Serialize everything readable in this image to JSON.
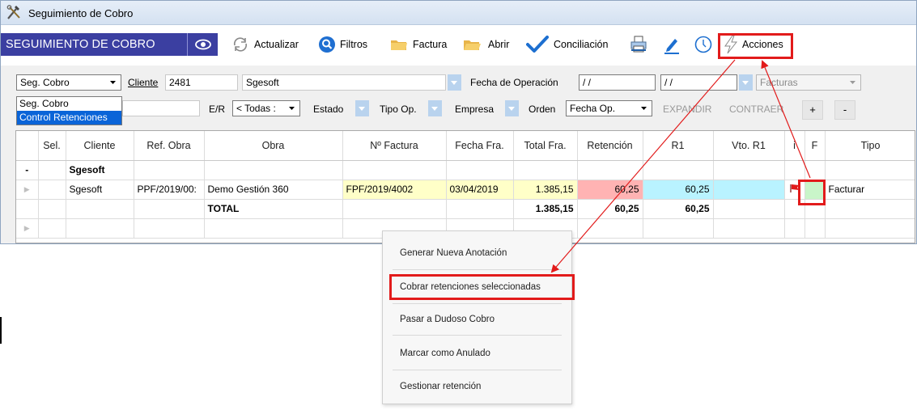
{
  "window": {
    "title": "Seguimiento de Cobro"
  },
  "toolbar": {
    "brand": "SEGUIMIENTO DE COBRO",
    "actualizar": "Actualizar",
    "filtros": "Filtros",
    "factura": "Factura",
    "abrir": "Abrir",
    "conciliacion": "Conciliación",
    "acciones": "Acciones"
  },
  "filters": {
    "mode_value": "Seg. Cobro",
    "mode_options": [
      "Seg. Cobro",
      "Control Retenciones"
    ],
    "cliente_label": "Cliente",
    "cliente_code": "2481",
    "cliente_name": "Sgesoft",
    "fecha_label": "Fecha de Operación",
    "fecha_from": "/ /",
    "fecha_to": "/ /",
    "doc_type": "Facturas",
    "er_label": "E/R",
    "er_value": "< Todas :",
    "estado_label": "Estado",
    "tipo_op_label": "Tipo Op.",
    "empresa_label": "Empresa",
    "orden_label": "Orden",
    "orden_value": "Fecha Op.",
    "expandir": "EXPANDIR",
    "contraer": "CONTRAER",
    "plus": "+",
    "minus": "-"
  },
  "grid": {
    "columns": [
      "Sel.",
      "Cliente",
      "Ref. Obra",
      "Obra",
      "Nº Factura",
      "Fecha Fra.",
      "Total Fra.",
      "Retención",
      "R1",
      "Vto. R1",
      "i",
      "F",
      "Tipo"
    ],
    "group": {
      "marker": "-",
      "name": "Sgesoft"
    },
    "row": {
      "cliente": "Sgesoft",
      "ref_obra": "PPF/2019/00:",
      "obra": "Demo Gestión 360",
      "factura": "FPF/2019/4002",
      "fecha": "03/04/2019",
      "total": "1.385,15",
      "retencion": "60,25",
      "r1": "60,25",
      "tipo": "Facturar"
    },
    "total": {
      "label": "TOTAL",
      "total": "1.385,15",
      "retencion": "60,25",
      "r1": "60,25"
    }
  },
  "context_menu": {
    "items": [
      "Generar Nueva Anotación",
      "Cobrar retenciones  seleccionadas",
      "Pasar a Dudoso Cobro",
      "Marcar como Anulado",
      "Gestionar retención"
    ]
  },
  "colors": {
    "brand_bg": "#3b3fa1",
    "highlight_red": "#e21b1b",
    "factura_bg": "#ffffc8",
    "retencion_bg": "#ffb3b3",
    "r1_bg": "#b9f3ff",
    "tipo_bg": "#c9f5c9"
  }
}
